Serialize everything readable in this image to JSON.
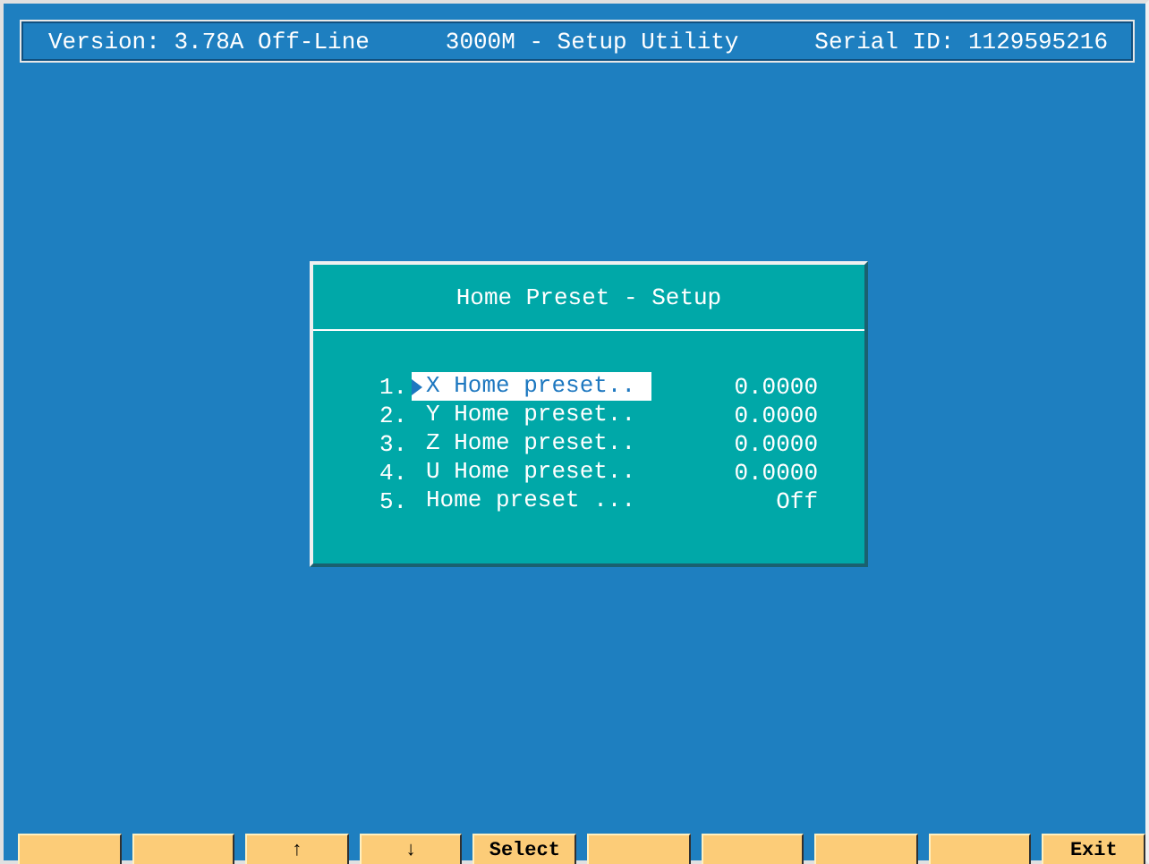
{
  "header": {
    "version": "Version: 3.78A Off-Line",
    "title": "3000M - Setup Utility",
    "serial": "Serial ID: 1129595216"
  },
  "dialog": {
    "title": "Home Preset - Setup",
    "items": [
      {
        "number": "1.",
        "label": "X Home preset..",
        "value": "0.0000",
        "selected": true
      },
      {
        "number": "2.",
        "label": "Y Home preset..",
        "value": "0.0000",
        "selected": false
      },
      {
        "number": "3.",
        "label": "Z Home preset..",
        "value": "0.0000",
        "selected": false
      },
      {
        "number": "4.",
        "label": "U Home preset..",
        "value": "0.0000",
        "selected": false
      },
      {
        "number": "5.",
        "label": "Home preset ...",
        "value": "Off",
        "selected": false
      }
    ]
  },
  "function_keys": [
    {
      "kind": "blank"
    },
    {
      "kind": "blank"
    },
    {
      "kind": "text",
      "label": "↑"
    },
    {
      "kind": "text",
      "label": "↓"
    },
    {
      "kind": "text",
      "label": "Select"
    },
    {
      "kind": "blank"
    },
    {
      "kind": "blank"
    },
    {
      "kind": "blank"
    },
    {
      "kind": "blank"
    },
    {
      "kind": "text",
      "label": "Exit"
    }
  ]
}
